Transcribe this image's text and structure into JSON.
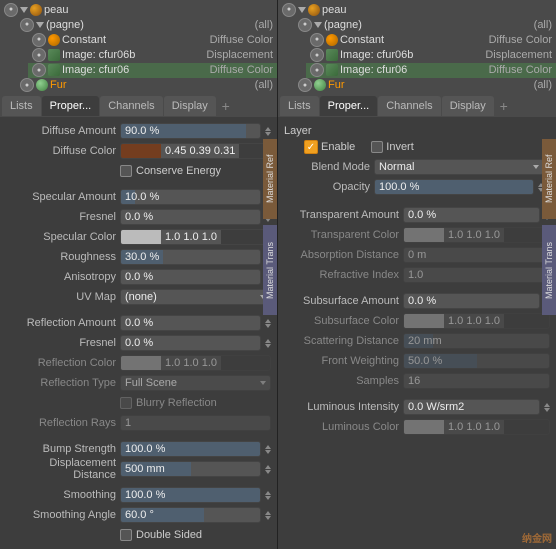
{
  "left": {
    "tree": {
      "rows": [
        {
          "id": "peau",
          "indent": 0,
          "label": "peau",
          "value": "",
          "type": "material",
          "expanded": true
        },
        {
          "id": "pagne",
          "indent": 1,
          "label": "(pagne)",
          "value": "(all)",
          "type": "group",
          "expanded": true
        },
        {
          "id": "constant",
          "indent": 2,
          "label": "Constant",
          "value": "Diffuse Color",
          "type": "shader"
        },
        {
          "id": "image1",
          "indent": 2,
          "label": "Image: cfur06b",
          "value": "Displacement",
          "type": "image"
        },
        {
          "id": "image2",
          "indent": 2,
          "label": "Image: cfur06",
          "value": "Diffuse Color",
          "type": "image",
          "selected": true
        },
        {
          "id": "fur",
          "indent": 1,
          "label": "Fur",
          "value": "(all)",
          "type": "fur"
        }
      ]
    },
    "tabs": {
      "items": [
        "Lists",
        "Proper...",
        "Channels",
        "Display"
      ],
      "active": 1
    },
    "properties": {
      "sections": [
        {
          "rows": [
            {
              "label": "Diffuse Amount",
              "value": "90.0 %",
              "type": "slider",
              "fill": 0.9
            },
            {
              "label": "Diffuse Color",
              "value": "0.45  0.39  0.31",
              "type": "color",
              "color": "#743d1f"
            },
            {
              "label": "",
              "value": "Conserve Energy",
              "type": "checkbox"
            }
          ]
        },
        {
          "rows": [
            {
              "label": "Specular Amount",
              "value": "10.0 %",
              "type": "slider",
              "fill": 0.1
            },
            {
              "label": "Fresnel",
              "value": "0.0 %",
              "type": "slider",
              "fill": 0
            },
            {
              "label": "Specular Color",
              "value": "1.0   1.0   1.0",
              "type": "color-white"
            },
            {
              "label": "Roughness",
              "value": "30.0 %",
              "type": "slider",
              "fill": 0.3
            },
            {
              "label": "Anisotropy",
              "value": "0.0 %",
              "type": "slider",
              "fill": 0
            },
            {
              "label": "UV Map",
              "value": "(none)",
              "type": "dropdown"
            }
          ]
        },
        {
          "rows": [
            {
              "label": "Reflection Amount",
              "value": "0.0 %",
              "type": "slider",
              "fill": 0
            },
            {
              "label": "Fresnel",
              "value": "0.0 %",
              "type": "slider",
              "fill": 0
            },
            {
              "label": "Reflection Color",
              "value": "1.0   1.0   1.0",
              "type": "color-white"
            },
            {
              "label": "Reflection Type",
              "value": "Full Scene",
              "type": "dropdown"
            },
            {
              "label": "",
              "value": "Blurry Reflection",
              "type": "checkbox"
            },
            {
              "label": "Reflection Rays",
              "value": "1",
              "type": "field"
            }
          ]
        },
        {
          "rows": [
            {
              "label": "Bump Strength",
              "value": "100.0 %",
              "type": "slider",
              "fill": 1.0
            },
            {
              "label": "Displacement Distance",
              "value": "500 mm",
              "type": "slider",
              "fill": 0.5
            }
          ]
        },
        {
          "rows": [
            {
              "label": "Smoothing",
              "value": "100.0 %",
              "type": "slider",
              "fill": 1.0
            },
            {
              "label": "Smoothing Angle",
              "value": "60.0 °",
              "type": "slider",
              "fill": 0.6
            },
            {
              "label": "",
              "value": "Double Sided",
              "type": "checkbox"
            }
          ]
        }
      ],
      "side_tabs": [
        {
          "id": "mat-ref",
          "label": "Material Ref"
        },
        {
          "id": "mat-trans",
          "label": "Material Trans"
        }
      ]
    }
  },
  "right": {
    "tree": {
      "rows": [
        {
          "id": "peau",
          "indent": 0,
          "label": "peau",
          "value": "",
          "type": "material",
          "expanded": true
        },
        {
          "id": "pagne",
          "indent": 1,
          "label": "(pagne)",
          "value": "(all)",
          "type": "group",
          "expanded": true
        },
        {
          "id": "constant",
          "indent": 2,
          "label": "Constant",
          "value": "Diffuse Color",
          "type": "shader"
        },
        {
          "id": "image1",
          "indent": 2,
          "label": "Image: cfur06b",
          "value": "Displacement",
          "type": "image"
        },
        {
          "id": "image2",
          "indent": 2,
          "label": "Image: cfur06",
          "value": "Diffuse Color",
          "type": "image",
          "selected": true
        },
        {
          "id": "fur",
          "indent": 1,
          "label": "Fur",
          "value": "(all)",
          "type": "fur"
        }
      ]
    },
    "tabs": {
      "items": [
        "Lists",
        "Proper...",
        "Channels",
        "Display"
      ],
      "active": 1
    },
    "layer": {
      "title": "Layer",
      "enable_label": "Enable",
      "invert_label": "Invert",
      "blend_mode_label": "Blend Mode",
      "blend_mode_value": "Normal",
      "opacity_label": "Opacity",
      "opacity_value": "100.0 %",
      "opacity_fill": 1.0
    },
    "properties": {
      "rows": [
        {
          "label": "Transparent Amount",
          "value": "0.0 %",
          "type": "slider",
          "fill": 0
        },
        {
          "label": "Transparent Color",
          "value": "1.0   1.0   1.0",
          "type": "color-white"
        },
        {
          "label": "Absorption Distance",
          "value": "0 m",
          "type": "slider-dim",
          "fill": 0
        },
        {
          "label": "Refractive Index",
          "value": "1.0",
          "type": "slider-dim",
          "fill": 0.1
        },
        {
          "divider": true
        },
        {
          "label": "Subsurface Amount",
          "value": "0.0 %",
          "type": "slider",
          "fill": 0
        },
        {
          "label": "Subsurface Color",
          "value": "1.0   1.0   1.0",
          "type": "color-white"
        },
        {
          "label": "Scattering Distance",
          "value": "20 mm",
          "type": "slider",
          "fill": 0.2
        },
        {
          "label": "Front Weighting",
          "value": "50.0 %",
          "type": "slider",
          "fill": 0.5
        },
        {
          "label": "Samples",
          "value": "16",
          "type": "field"
        },
        {
          "divider": true
        },
        {
          "label": "Luminous Intensity",
          "value": "0.0 W/srm2",
          "type": "slider",
          "fill": 0
        },
        {
          "label": "Luminous Color",
          "value": "1.0   1.0   1.0",
          "type": "color-white"
        }
      ],
      "side_tabs": [
        {
          "id": "mat-ref",
          "label": "Material Ref"
        },
        {
          "id": "mat-trans",
          "label": "Material Trans"
        }
      ]
    }
  },
  "icons": {
    "triangle_right": "▶",
    "triangle_down": "▼",
    "check": "✓",
    "plus": "+"
  }
}
